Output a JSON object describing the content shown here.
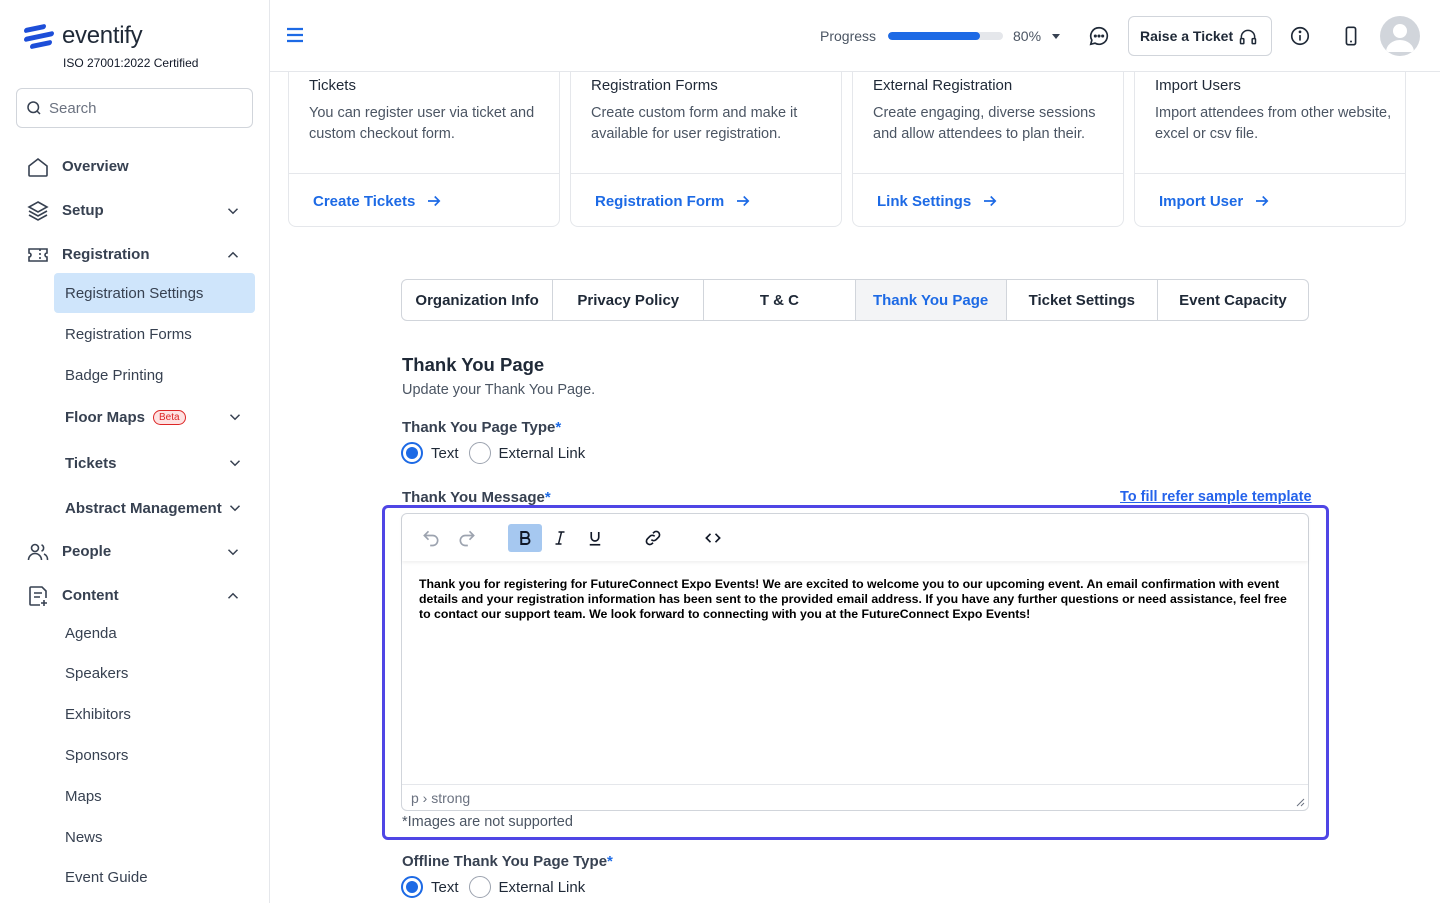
{
  "brand": {
    "name": "eventify",
    "certification": "ISO 27001:2022 Certified",
    "accent": "#1d6ae5"
  },
  "search": {
    "placeholder": "Search"
  },
  "sidebar": {
    "overview": "Overview",
    "setup": "Setup",
    "registration": "Registration",
    "registration_children": {
      "settings": "Registration Settings",
      "forms": "Registration Forms",
      "badge": "Badge Printing",
      "floor_maps": "Floor Maps",
      "floor_maps_badge": "Beta",
      "tickets": "Tickets",
      "abstract": "Abstract Management"
    },
    "people": "People",
    "content": "Content",
    "content_children": {
      "agenda": "Agenda",
      "speakers": "Speakers",
      "exhibitors": "Exhibitors",
      "sponsors": "Sponsors",
      "maps": "Maps",
      "news": "News",
      "event_guide": "Event Guide"
    }
  },
  "header": {
    "progress_label": "Progress",
    "progress_value": "80%",
    "progress_fraction": 0.8,
    "raise_ticket": "Raise a Ticket"
  },
  "cards": [
    {
      "title": "Tickets",
      "desc": "You can register user via ticket and custom checkout form.",
      "link": "Create Tickets"
    },
    {
      "title": "Registration Forms",
      "desc": "Create custom form and make it available for user registration.",
      "link": "Registration Form"
    },
    {
      "title": "External Registration",
      "desc": "Create engaging, diverse sessions and allow attendees to plan their.",
      "link": "Link Settings"
    },
    {
      "title": "Import Users",
      "desc": "Import attendees from other website, excel or csv file.",
      "link": "Import User"
    }
  ],
  "tabs": [
    "Organization Info",
    "Privacy Policy",
    "T & C",
    "Thank You Page",
    "Ticket Settings",
    "Event Capacity"
  ],
  "active_tab": "Thank You Page",
  "section": {
    "title": "Thank You Page",
    "subtitle": "Update your Thank You Page."
  },
  "form": {
    "type_label": "Thank You Page Type",
    "required_mark": "*",
    "option_text": "Text",
    "option_link": "External Link",
    "message_label": "Thank You Message",
    "sample_link": "To fill refer sample template",
    "message": "Thank you for registering for FutureConnect Expo Events! We are excited to welcome you to our upcoming event. An email confirmation with event details and your registration information has been sent to the provided email address. If you have any further questions or need assistance, feel free to contact our support team. We look forward to connecting with you at the FutureConnect Expo Events!",
    "editor_path": "p › strong",
    "note": "*Images are not supported",
    "offline_label": "Offline Thank You Page Type"
  }
}
